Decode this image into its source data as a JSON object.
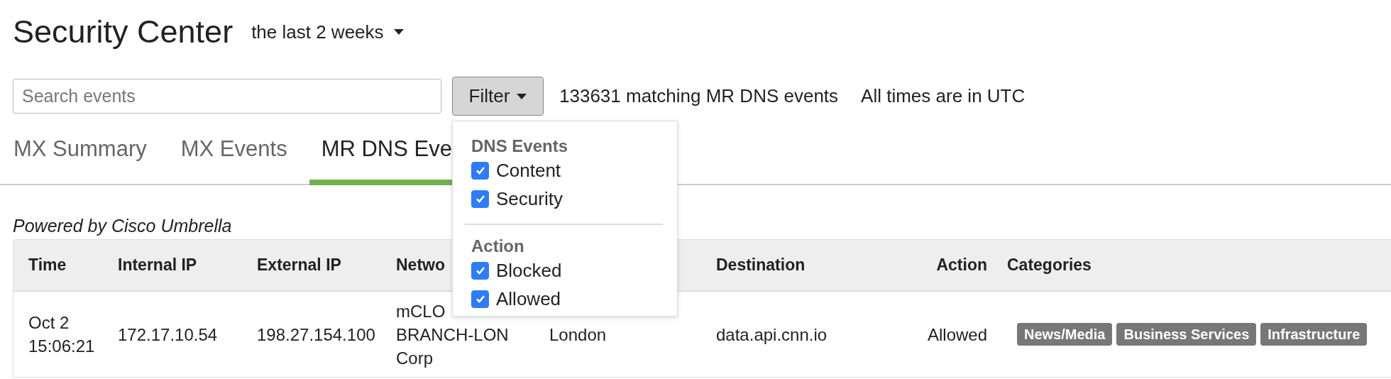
{
  "header": {
    "title": "Security Center",
    "period": "the last 2 weeks"
  },
  "toolbar": {
    "search": {
      "placeholder": "Search events"
    },
    "filter_button": "Filter",
    "match_count": "133631 matching MR DNS events",
    "timezone_note": "All times are in UTC"
  },
  "tabs": [
    {
      "label": "MX Summary",
      "selected": false
    },
    {
      "label": "MX Events",
      "selected": false
    },
    {
      "label": "MR DNS Eve",
      "selected": true
    }
  ],
  "filter_menu": {
    "groups": [
      {
        "title": "DNS Events",
        "options": [
          {
            "label": "Content",
            "checked": true
          },
          {
            "label": "Security",
            "checked": true
          }
        ]
      },
      {
        "title": "Action",
        "options": [
          {
            "label": "Blocked",
            "checked": true
          },
          {
            "label": "Allowed",
            "checked": true
          }
        ]
      }
    ]
  },
  "powered_by": "Powered by Cisco Umbrella",
  "table": {
    "columns": [
      "Time",
      "Internal IP",
      "External IP",
      "Netwo",
      "",
      "Destination",
      "Action",
      "Categories"
    ],
    "rows": [
      {
        "time": "Oct 2\n15:06:21",
        "internal_ip": "172.17.10.54",
        "external_ip": "198.27.154.100",
        "network": "mCLO\nBRANCH-LON\nCorp",
        "column_5": "London",
        "destination": "data.api.cnn.io",
        "action": "Allowed",
        "categories": [
          "News/Media",
          "Business Services",
          "Infrastructure"
        ]
      }
    ]
  }
}
